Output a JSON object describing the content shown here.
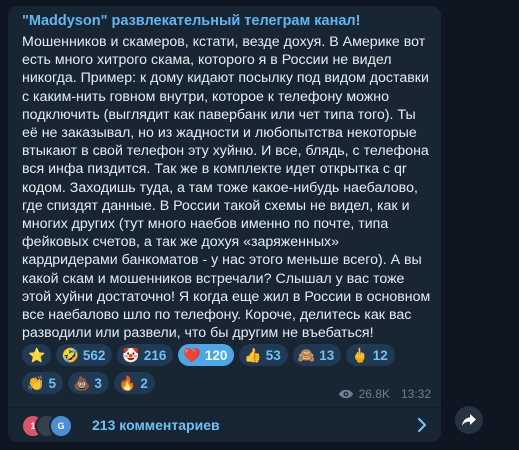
{
  "post": {
    "channel_name": "\"Maddyson\" развлекательный телеграм канал!",
    "text": "Мошенников и скамеров, кстати, везде дохуя. В Америке вот есть много хитрого скама, которого я в России не видел никогда. Пример: к дому кидают посылку под видом доставки с каким-нить говном внутри, которое к телефону можно подключить (выглядит как павербанк или чет типа того). Ты её не заказывал, но из жадности и любопытства некоторые втыкают в свой телефон эту хуйню. И все, блядь, с телефона вся инфа пиздится. Так же в комплекте идет открытка с qr кодом. Заходишь туда, а там тоже какое-нибудь наебалово, где спиздят данные. В России такой схемы не видел, как и многих других (тут много наебов именно по почте, типа фейковых счетов, а так же дохуя «заряженных» кардридерами банкоматов - у нас этого меньше всего). А вы какой скам и мошенников встречали? Слышал у вас тоже этой хуйни достаточно! Я когда еще жил в России в основном все наебалово шло по телефону. Короче, делитесь как вас разводили или развели, что бы другим не въебаться!"
  },
  "reactions": [
    {
      "emoji": "⭐",
      "count": ""
    },
    {
      "emoji": "🤣",
      "count": "562"
    },
    {
      "emoji": "🤡",
      "count": "216"
    },
    {
      "emoji": "❤️",
      "count": "120",
      "active": true
    },
    {
      "emoji": "👍",
      "count": "53"
    },
    {
      "emoji": "🙈",
      "count": "13"
    },
    {
      "emoji": "🖕",
      "count": "12"
    },
    {
      "emoji": "👏",
      "count": "5"
    },
    {
      "emoji": "💩",
      "count": "3"
    },
    {
      "emoji": "🔥",
      "count": "2"
    }
  ],
  "meta": {
    "views": "26.8K",
    "time": "13:32",
    "views_icon": "eye-icon"
  },
  "comments": {
    "label": "213 комментариев",
    "avatars": [
      {
        "letter": "1",
        "color": "#e0546b"
      },
      {
        "letter": "",
        "color": "#33414f"
      },
      {
        "letter": "G",
        "color": "#4b8fd6"
      }
    ]
  },
  "icons": {
    "share": "share-arrow-icon",
    "chevron": "chevron-right-icon"
  }
}
